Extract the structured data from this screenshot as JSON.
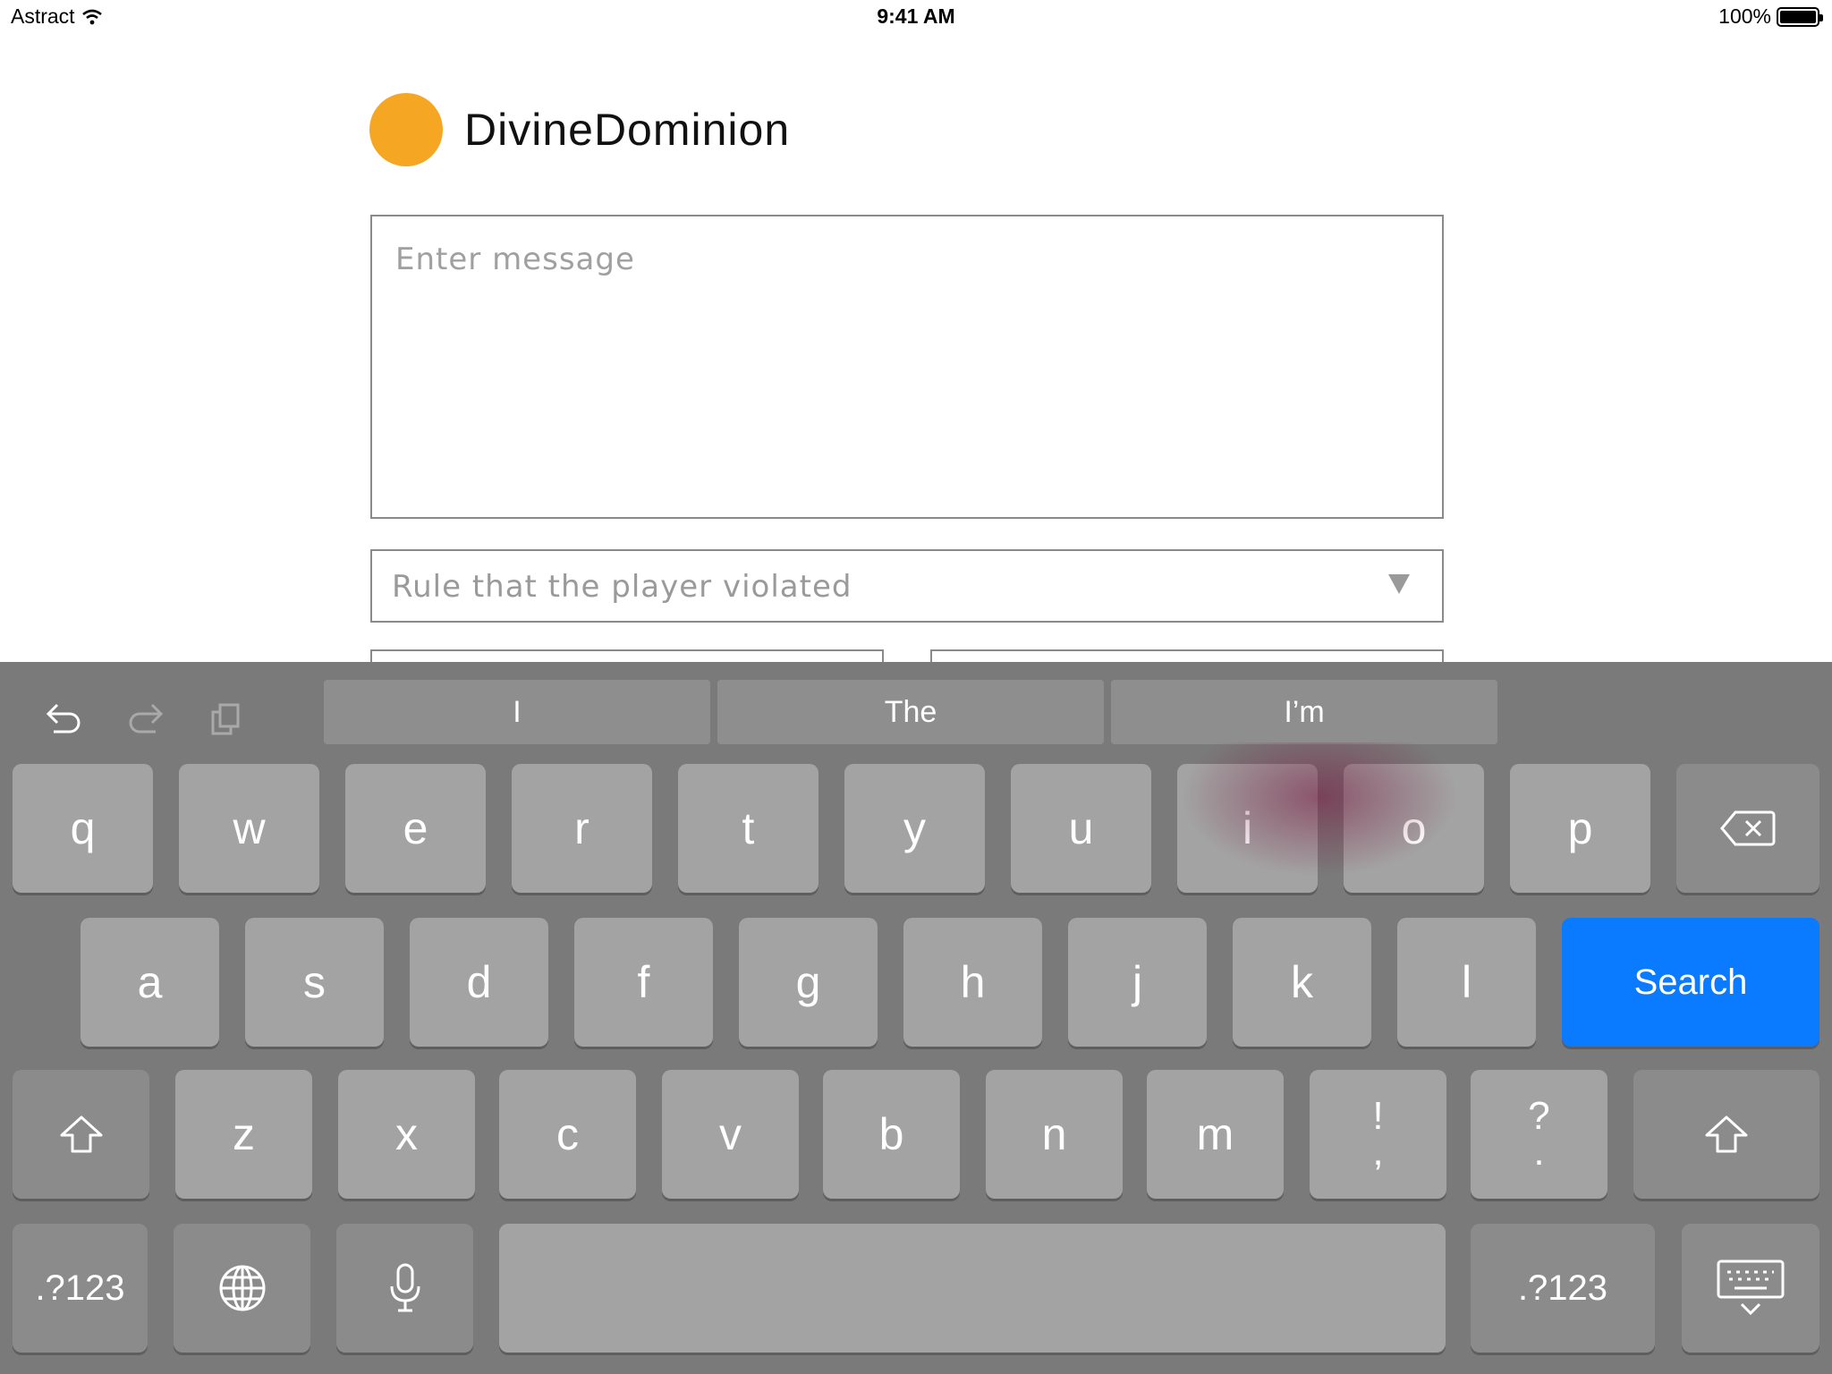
{
  "status_bar": {
    "carrier": "Astract",
    "time": "9:41 AM",
    "battery": "100%"
  },
  "header": {
    "username": "DivineDominion",
    "avatar_color": "#F5A623"
  },
  "form": {
    "message_placeholder": "Enter message",
    "rule_select_placeholder": "Rule that the player violated"
  },
  "keyboard": {
    "suggestions": [
      "I",
      "The",
      "I’m"
    ],
    "row1": [
      "q",
      "w",
      "e",
      "r",
      "t",
      "y",
      "u",
      "i",
      "o",
      "p"
    ],
    "row2": [
      "a",
      "s",
      "d",
      "f",
      "g",
      "h",
      "j",
      "k",
      "l"
    ],
    "row3": [
      "z",
      "x",
      "c",
      "v",
      "b",
      "n",
      "m"
    ],
    "punct1": {
      "top": "!",
      "bottom": ","
    },
    "punct2": {
      "top": "?",
      "bottom": "."
    },
    "search_label": "Search",
    "numbers_label": ".?123",
    "accent_color": "#0A7AFF"
  }
}
